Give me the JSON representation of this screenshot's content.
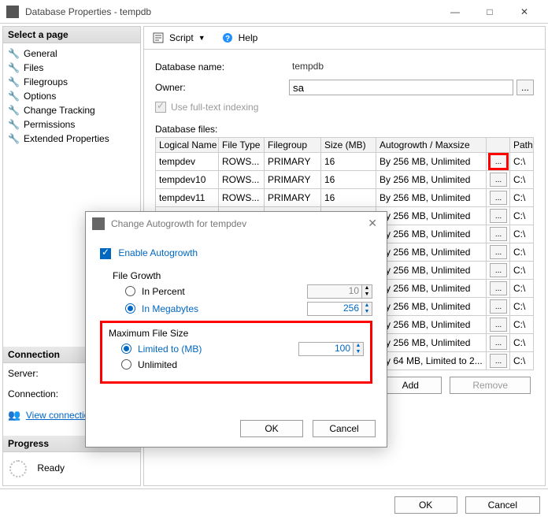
{
  "window": {
    "title": "Database Properties - tempdb",
    "min": "—",
    "max": "□",
    "close": "✕"
  },
  "sidebar": {
    "header": "Select a page",
    "items": [
      {
        "label": "General"
      },
      {
        "label": "Files"
      },
      {
        "label": "Filegroups"
      },
      {
        "label": "Options"
      },
      {
        "label": "Change Tracking"
      },
      {
        "label": "Permissions"
      },
      {
        "label": "Extended Properties"
      }
    ],
    "connection_header": "Connection",
    "server_label": "Server:",
    "connection_label": "Connection:",
    "view_link": "View connectio",
    "progress_header": "Progress",
    "progress_status": "Ready"
  },
  "toolbar": {
    "script": "Script",
    "help": "Help"
  },
  "form": {
    "dbname_label": "Database name:",
    "dbname_value": "tempdb",
    "owner_label": "Owner:",
    "owner_value": "sa",
    "fulltext_label": "Use full-text indexing",
    "files_label": "Database files:"
  },
  "grid": {
    "headers": [
      "Logical Name",
      "File Type",
      "Filegroup",
      "Size (MB)",
      "Autogrowth / Maxsize",
      "",
      "Path"
    ],
    "rows": [
      {
        "name": "tempdev",
        "type": "ROWS...",
        "fg": "PRIMARY",
        "size": "16",
        "ag": "By 256 MB, Unlimited",
        "hl": true,
        "path": "C:\\"
      },
      {
        "name": "tempdev10",
        "type": "ROWS...",
        "fg": "PRIMARY",
        "size": "16",
        "ag": "By 256 MB, Unlimited",
        "path": "C:\\"
      },
      {
        "name": "tempdev11",
        "type": "ROWS...",
        "fg": "PRIMARY",
        "size": "16",
        "ag": "By 256 MB, Unlimited",
        "path": "C:\\"
      },
      {
        "name": "",
        "type": "",
        "fg": "",
        "size": "",
        "ag": "By 256 MB, Unlimited",
        "path": "C:\\"
      },
      {
        "name": "",
        "type": "",
        "fg": "",
        "size": "",
        "ag": "By 256 MB, Unlimited",
        "path": "C:\\"
      },
      {
        "name": "",
        "type": "",
        "fg": "",
        "size": "",
        "ag": "By 256 MB, Unlimited",
        "path": "C:\\"
      },
      {
        "name": "",
        "type": "",
        "fg": "",
        "size": "",
        "ag": "By 256 MB, Unlimited",
        "path": "C:\\"
      },
      {
        "name": "",
        "type": "",
        "fg": "",
        "size": "",
        "ag": "By 256 MB, Unlimited",
        "path": "C:\\"
      },
      {
        "name": "",
        "type": "",
        "fg": "",
        "size": "",
        "ag": "By 256 MB, Unlimited",
        "path": "C:\\"
      },
      {
        "name": "",
        "type": "",
        "fg": "",
        "size": "",
        "ag": "By 256 MB, Unlimited",
        "path": "C:\\"
      },
      {
        "name": "",
        "type": "",
        "fg": "",
        "size": "",
        "ag": "By 256 MB, Unlimited",
        "path": "C:\\"
      },
      {
        "name": "",
        "type": "",
        "fg": "",
        "size": "",
        "ag": "By 64 MB, Limited to 2...",
        "path": "C:\\"
      }
    ],
    "add_btn": "Add",
    "remove_btn": "Remove"
  },
  "footer": {
    "ok": "OK",
    "cancel": "Cancel"
  },
  "dialog": {
    "title": "Change Autogrowth for tempdev",
    "enable": "Enable Autogrowth",
    "file_growth": "File Growth",
    "in_percent": "In Percent",
    "percent_val": "10",
    "in_mb": "In Megabytes",
    "mb_val": "256",
    "max_size": "Maximum File Size",
    "limited": "Limited to (MB)",
    "limited_val": "100",
    "unlimited": "Unlimited",
    "ok": "OK",
    "cancel": "Cancel"
  }
}
